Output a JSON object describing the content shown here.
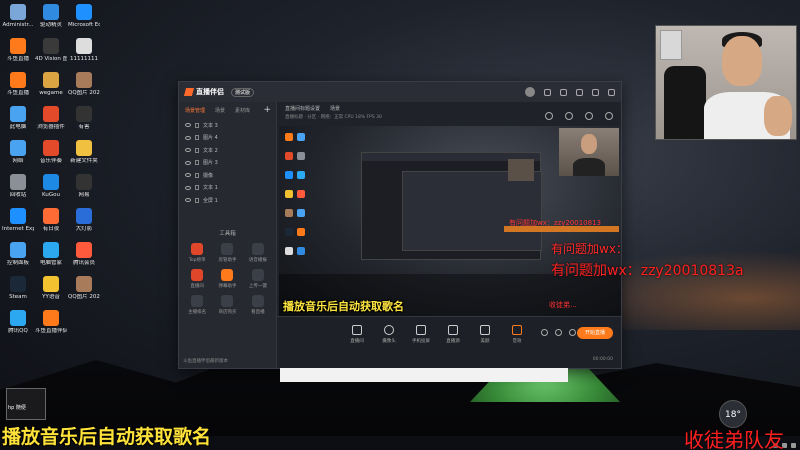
{
  "desktop": {
    "icons": [
      {
        "label": "Administr...",
        "color": "#7aa7d8"
      },
      {
        "label": "驱动精灵",
        "color": "#2f8ae0"
      },
      {
        "label": "Microsoft Edge",
        "color": "#1e90ff"
      },
      {
        "label": "斗鱼直播",
        "color": "#ff7a1a"
      },
      {
        "label": "4D Vision 图片查看",
        "color": "#3a3a3a"
      },
      {
        "label": "11111111",
        "color": "#dddddd"
      },
      {
        "label": "斗鱼直播",
        "color": "#ff7a1a"
      },
      {
        "label": "wegame",
        "color": "#d9a441"
      },
      {
        "label": "QQ图片 20210725...",
        "color": "#a87b5b"
      },
      {
        "label": "此电脑",
        "color": "#4aa3f0"
      },
      {
        "label": "浏览器插件",
        "color": "#e34a2a"
      },
      {
        "label": "有害",
        "color": "#333333"
      },
      {
        "label": "网络",
        "color": "#4aa3f0"
      },
      {
        "label": "音乐伴奏",
        "color": "#e34a2a"
      },
      {
        "label": "新建文件夹",
        "color": "#f0c040"
      },
      {
        "label": "回收站",
        "color": "#8a8f98"
      },
      {
        "label": "KuGou",
        "color": "#1e88e5"
      },
      {
        "label": "网易",
        "color": "#333333"
      },
      {
        "label": "Internet Explorer",
        "color": "#1e90ff"
      },
      {
        "label": "有日夜",
        "color": "#ff6b35"
      },
      {
        "label": "大灯影",
        "color": "#2a6cd8"
      },
      {
        "label": "控制面板",
        "color": "#4aa3f0"
      },
      {
        "label": "电脑管家",
        "color": "#2ca8f0"
      },
      {
        "label": "腾讯会员",
        "color": "#ff5a3c"
      },
      {
        "label": "Steam",
        "color": "#1b2838"
      },
      {
        "label": "YY语音",
        "color": "#f2c230"
      },
      {
        "label": "QQ图片 20210701...",
        "color": "#a87b5b"
      },
      {
        "label": "腾讯QQ",
        "color": "#2ca8f0"
      },
      {
        "label": "斗鱼直播伴侣",
        "color": "#ff7a1a"
      }
    ],
    "start_label": "hp 随便"
  },
  "app": {
    "title": "直播伴侣",
    "version_badge": "测试版",
    "left_tabs": [
      "场景管理",
      "场景",
      "素材库"
    ],
    "add_label": "+",
    "scenes": [
      "文本 3",
      "图片 4",
      "文本 2",
      "图片 3",
      "摄像",
      "文本 1",
      "全屏 1"
    ],
    "tools_title": "工具箱",
    "tools": [
      "Top榜单",
      "房管助手",
      "语音播报",
      "直播间",
      "弹幕助手",
      "上传一键",
      "主播排名",
      "商店购买",
      "看直播"
    ],
    "footer_text": "斗鱼直播伴侣最新版本",
    "main_tabs": [
      "直播间标题设置",
      "场景"
    ],
    "info_text": "直播标题 · 分区 · 网络：正常  CPU 18%  FPS 30",
    "bottom_items": [
      "直播间",
      "摄像头",
      "手机投屏",
      "直播源",
      "美颜",
      "音效"
    ],
    "go_live": "开始直播",
    "timer": "00:00:00"
  },
  "preview": {
    "line1": "有问题加wx：zzy20010813",
    "line2": "有问题加wx：zzy20010813a",
    "caption": "播放音乐后自动获取歌名",
    "red_small": "收徒弟..."
  },
  "overlays": {
    "contact": "有问题加wx：zzy20010813a",
    "caption": "播放音乐后自动获取歌名",
    "bottom_right": "收徒弟队友"
  },
  "weather": {
    "temp": "18°"
  },
  "colors": {
    "accent": "#ff7a1a",
    "caption": "#ffe33a",
    "alert": "#ff2020"
  }
}
